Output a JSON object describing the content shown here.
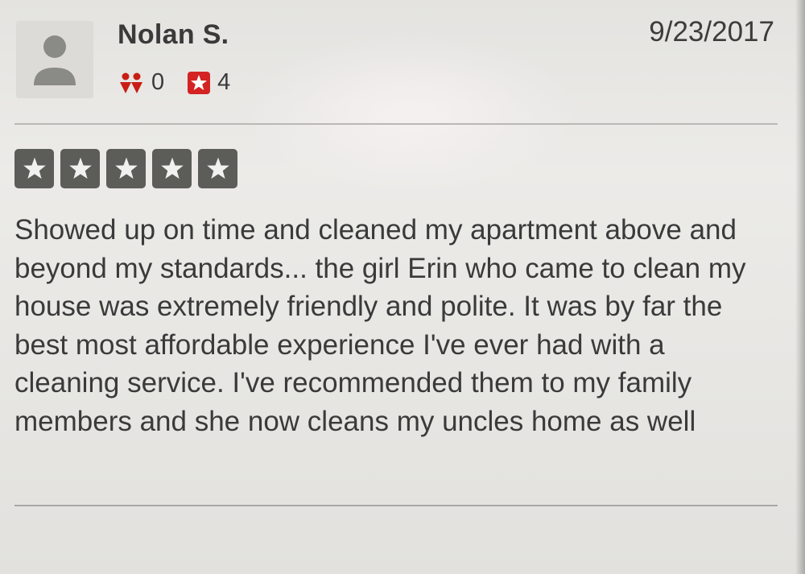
{
  "review": {
    "user_name": "Nolan S.",
    "date": "9/23/2017",
    "friends_count": "0",
    "reviews_count": "4",
    "rating": 5,
    "text": "Showed up on time and cleaned my apartment above and beyond my standards... the girl Erin who came to clean my house was extremely friendly and polite. It was by far the best most affordable experience I've ever had with a cleaning service. I've recommended them to my family members and she now cleans my uncles home as well"
  },
  "icons": {
    "avatar": "avatar-placeholder-icon",
    "friends": "friends-icon",
    "reviews": "review-star-icon",
    "rating_star": "star-icon"
  },
  "colors": {
    "friends_icon": "#c81e14",
    "reviews_icon": "#d32323",
    "star_box": "#5c5c59"
  }
}
